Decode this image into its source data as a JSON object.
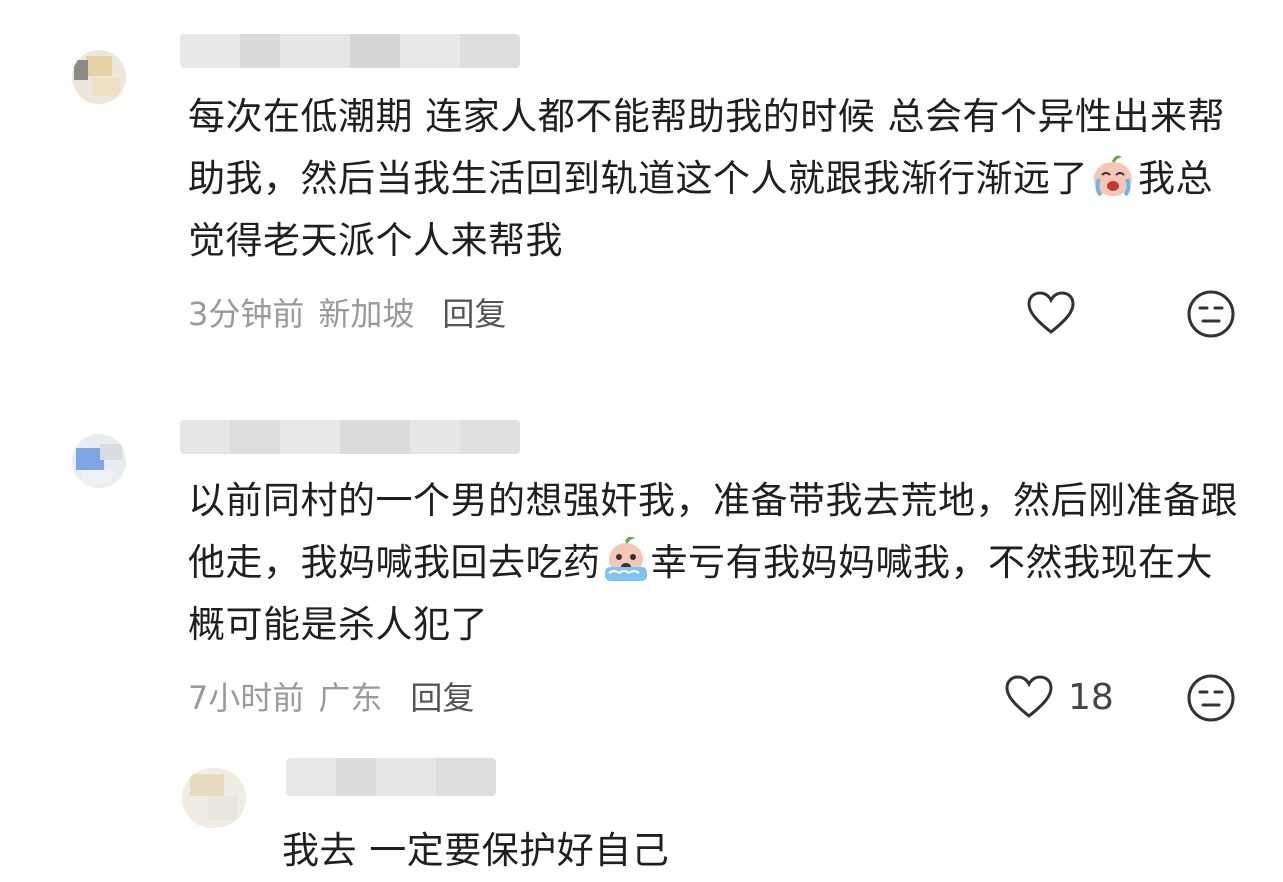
{
  "comments": [
    {
      "text_parts": [
        "每次在低潮期 连家人都不能帮助我的时候 总会有个异性出来帮助我，然后当我生活回到轨道这个人就跟我渐行渐远了",
        "我总觉得老天派个人来帮我"
      ],
      "emoji": "crying-face-emoji",
      "time": "3分钟前",
      "location": "新加坡",
      "reply_label": "回复",
      "likes": ""
    },
    {
      "text_parts": [
        "以前同村的一个男的想强奸我，准备带我去荒地，然后刚准备跟他走，我妈喊我回去吃药",
        "幸亏有我妈妈喊我，不然我现在大概可能是杀人犯了"
      ],
      "emoji": "tears-face-emoji",
      "time": "7小时前",
      "location": "广东",
      "reply_label": "回复",
      "likes": "18"
    },
    {
      "text_parts": [
        "我去 一定要保护好自己"
      ]
    }
  ],
  "colors": {
    "text": "#1f1f1f",
    "meta": "#9a9a9a",
    "reply": "#555555",
    "icon": "#333333"
  },
  "icons": [
    "heart-outline-icon",
    "neutral-face-icon"
  ]
}
